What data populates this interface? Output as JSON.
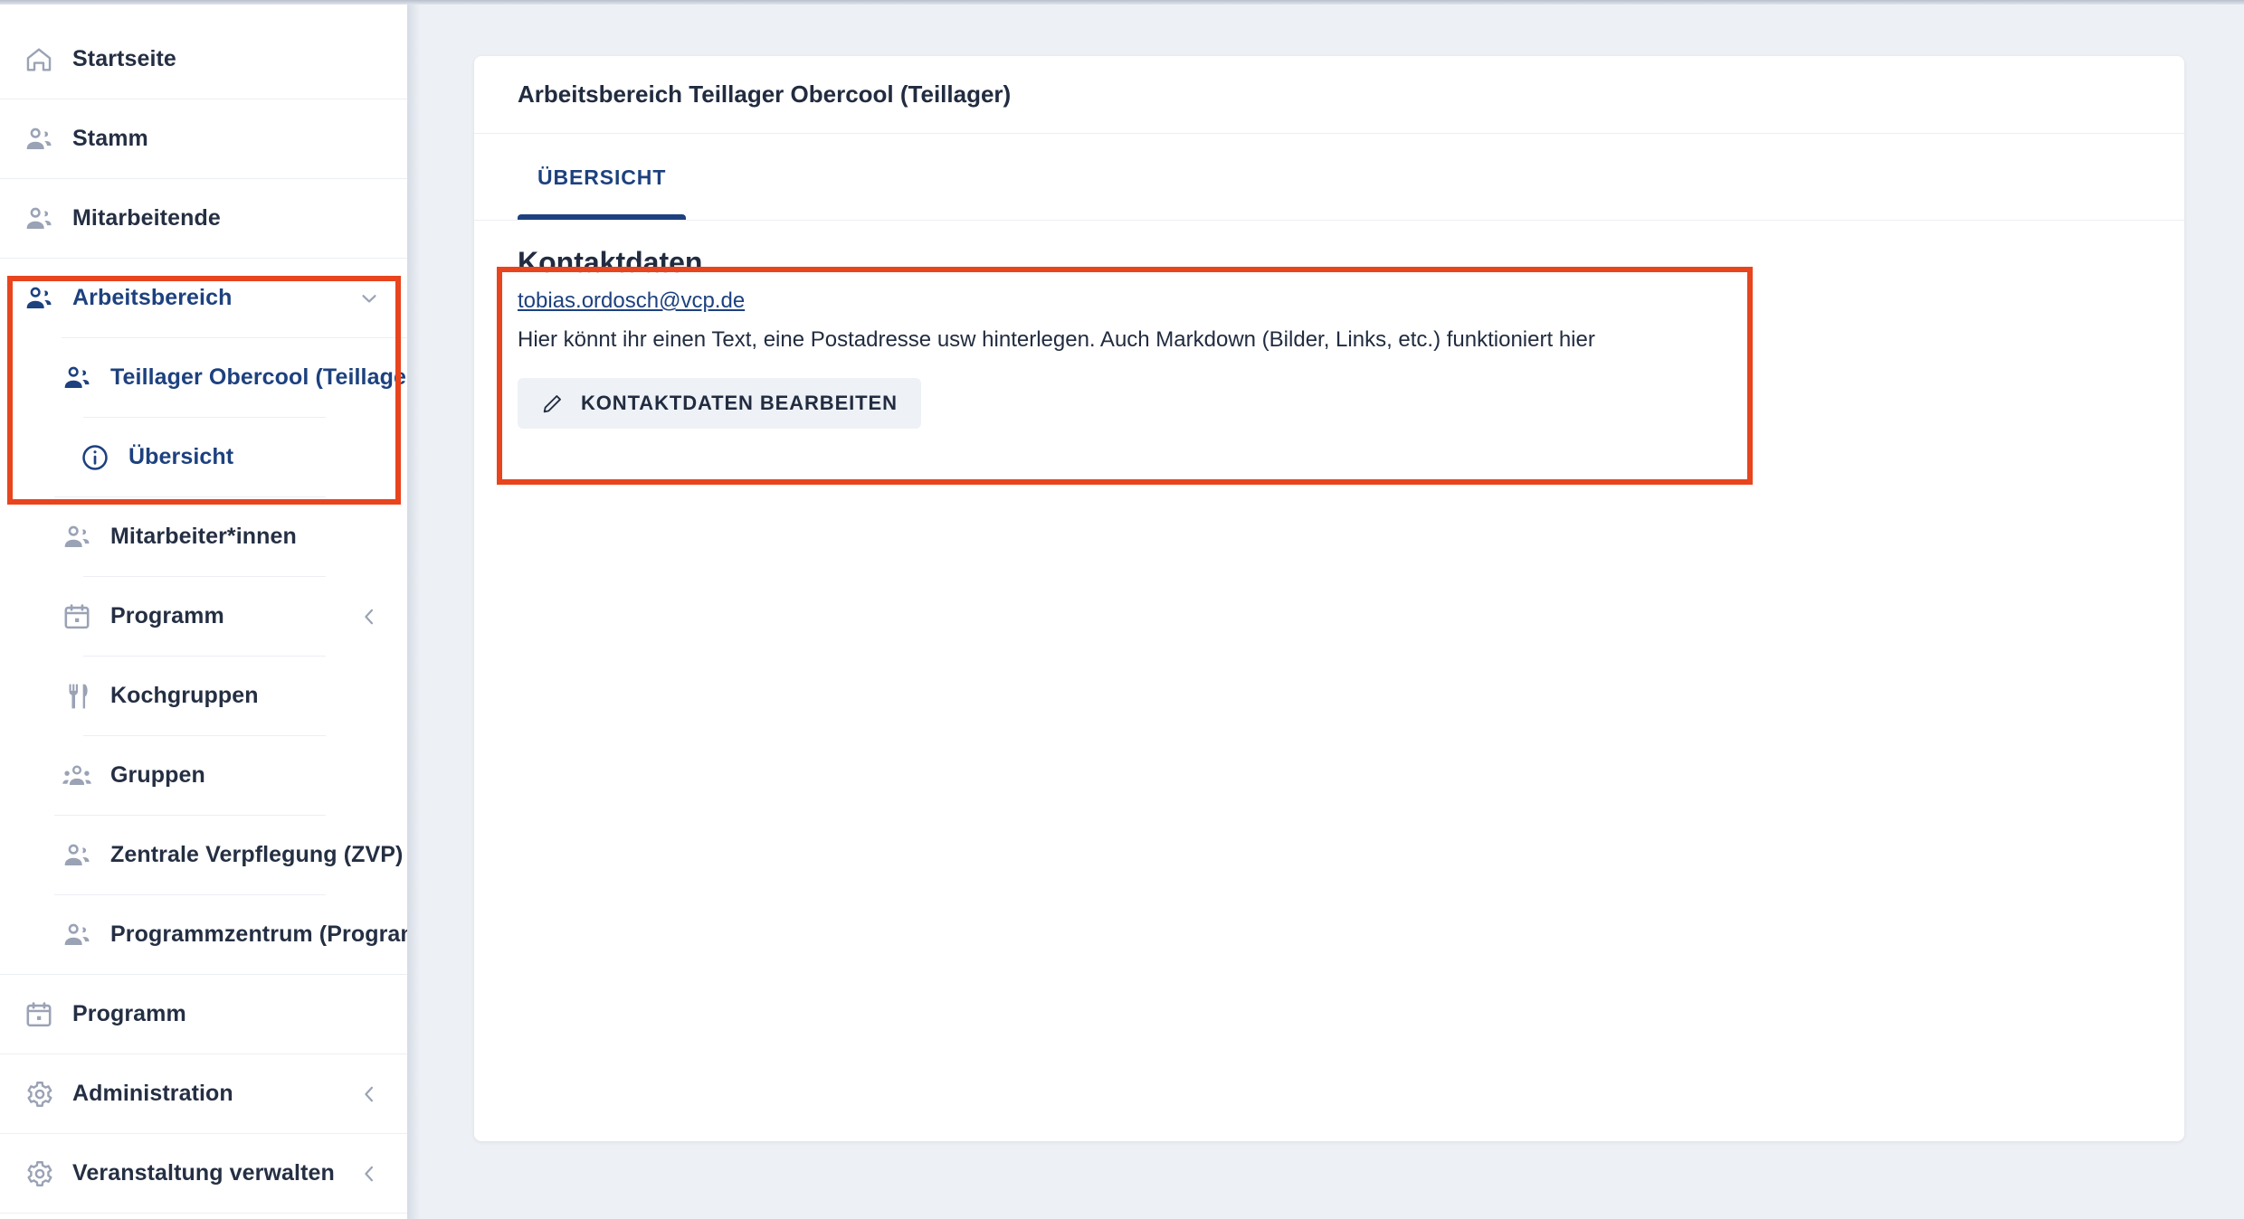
{
  "sidebar": {
    "items": [
      {
        "label": "Startseite",
        "icon": "home-icon",
        "depth": 1,
        "active": false,
        "chevron": ""
      },
      {
        "label": "Stamm",
        "icon": "people-icon",
        "depth": 1,
        "active": false,
        "chevron": ""
      },
      {
        "label": "Mitarbeitende",
        "icon": "people-icon",
        "depth": 1,
        "active": false,
        "chevron": ""
      },
      {
        "label": "Arbeitsbereich",
        "icon": "people-icon",
        "depth": 1,
        "active": true,
        "chevron": "chevron-down-icon"
      },
      {
        "label": "Teillager Obercool (Teillager)",
        "icon": "people-icon",
        "depth": 2,
        "active": true,
        "chevron": ""
      },
      {
        "label": "Übersicht",
        "icon": "info-icon",
        "depth": 3,
        "active": true,
        "chevron": ""
      },
      {
        "label": "Mitarbeiter*innen",
        "icon": "people-icon",
        "depth": 2,
        "active": false,
        "chevron": ""
      },
      {
        "label": "Programm",
        "icon": "calendar-icon",
        "depth": 2,
        "active": false,
        "chevron": "chevron-left-icon"
      },
      {
        "label": "Kochgruppen",
        "icon": "cutlery-icon",
        "depth": 2,
        "active": false,
        "chevron": ""
      },
      {
        "label": "Gruppen",
        "icon": "group-icon",
        "depth": 2,
        "active": false,
        "chevron": ""
      },
      {
        "label": "Zentrale Verpflegung (ZVP)",
        "icon": "people-icon",
        "depth": 2,
        "active": false,
        "chevron": ""
      },
      {
        "label": "Programmzentrum (Programm",
        "icon": "people-icon",
        "depth": 2,
        "active": false,
        "chevron": ""
      },
      {
        "label": "Programm",
        "icon": "calendar-icon",
        "depth": 1,
        "active": false,
        "chevron": ""
      },
      {
        "label": "Administration",
        "icon": "gear-icon",
        "depth": 1,
        "active": false,
        "chevron": "chevron-left-icon"
      },
      {
        "label": "Veranstaltung verwalten",
        "icon": "gear-icon",
        "depth": 1,
        "active": false,
        "chevron": "chevron-left-icon"
      }
    ]
  },
  "main": {
    "card_title": "Arbeitsbereich Teillager Obercool (Teillager)",
    "tabs": [
      {
        "label": "ÜBERSICHT",
        "selected": true
      }
    ],
    "contact": {
      "heading": "Kontaktdaten",
      "email": "tobias.ordosch@vcp.de",
      "description": "Hier könnt ihr einen Text, eine Postadresse usw hinterlegen. Auch Markdown (Bilder, Links, etc.) funktioniert hier",
      "edit_button_label": "KONTAKTDATEN BEARBEITEN",
      "edit_button_icon": "pencil-icon"
    }
  },
  "annotations": {
    "color": "#e8441d",
    "boxes": [
      {
        "name": "sidebar-arbeitsbereich-highlight"
      },
      {
        "name": "kontaktdaten-highlight"
      }
    ]
  },
  "colors": {
    "accent_blue": "#1d417f",
    "text_dark": "#222c40",
    "icon_gray": "#9aa3b5",
    "page_bg": "#edf0f5",
    "annotation_red": "#e8441d"
  }
}
